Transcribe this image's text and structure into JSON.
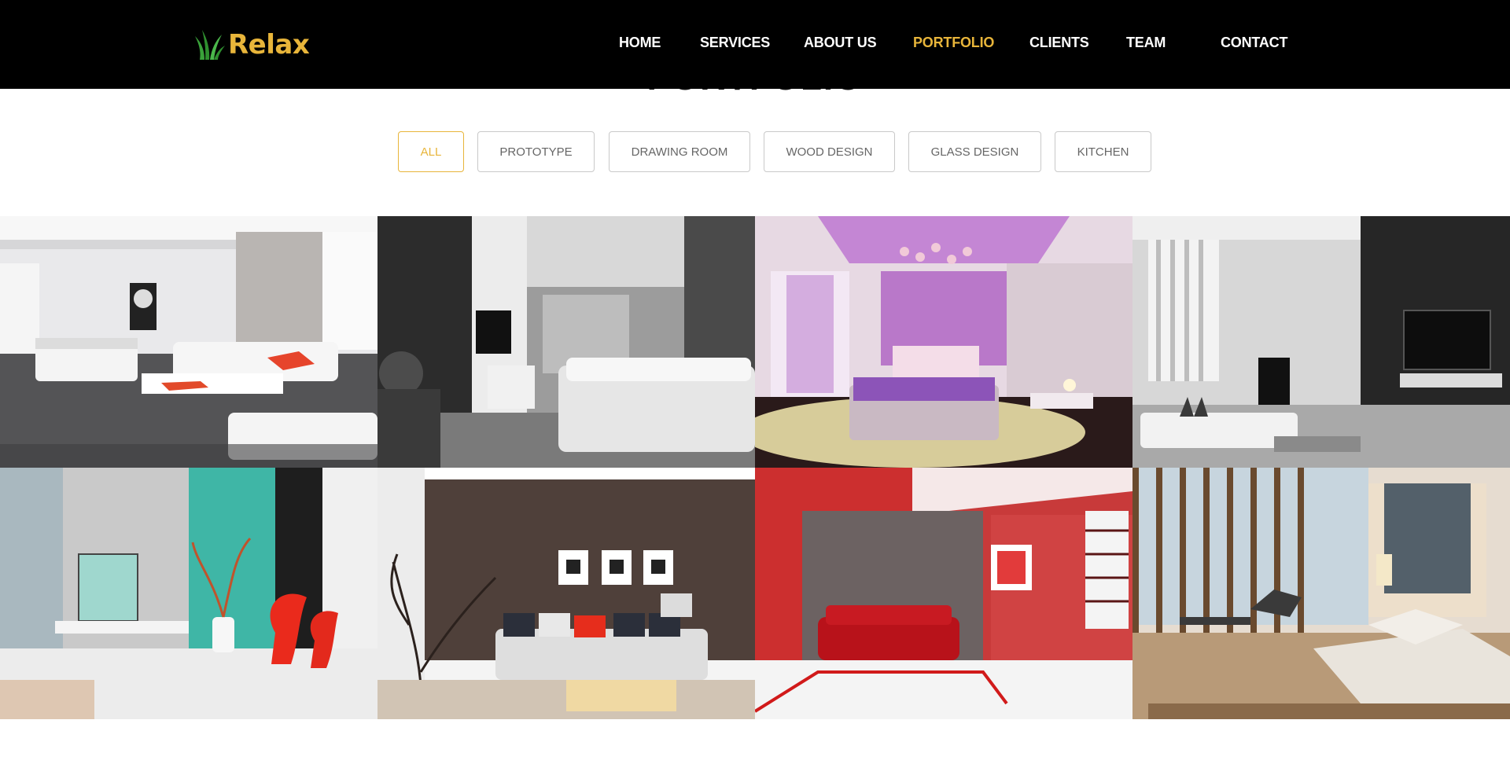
{
  "brand": {
    "name": "Relax",
    "icon": "grass-leaf-icon",
    "accent_color": "#e8b53a"
  },
  "nav": {
    "items": [
      {
        "label": "HOME",
        "active": false
      },
      {
        "label": "SERVICES",
        "active": false
      },
      {
        "label": "ABOUT US",
        "active": false
      },
      {
        "label": "PORTFOLIO",
        "active": true
      },
      {
        "label": "CLIENTS",
        "active": false
      },
      {
        "label": "TEAM",
        "active": false
      },
      {
        "label": "CONTACT",
        "active": false
      }
    ]
  },
  "portfolio": {
    "heading": "PORTFOLIO",
    "filters": [
      {
        "label": "ALL",
        "active": true
      },
      {
        "label": "PROTOTYPE",
        "active": false
      },
      {
        "label": "DRAWING ROOM",
        "active": false
      },
      {
        "label": "WOOD DESIGN",
        "active": false
      },
      {
        "label": "GLASS DESIGN",
        "active": false
      },
      {
        "label": "KITCHEN",
        "active": false
      }
    ],
    "items": [
      {
        "name": "white-living-room-image"
      },
      {
        "name": "monochrome-bedroom-image"
      },
      {
        "name": "purple-bedroom-image"
      },
      {
        "name": "grey-living-room-image"
      },
      {
        "name": "teal-living-room-image"
      },
      {
        "name": "brown-lounge-image"
      },
      {
        "name": "red-living-room-image"
      },
      {
        "name": "sunlit-bedroom-image"
      }
    ]
  }
}
